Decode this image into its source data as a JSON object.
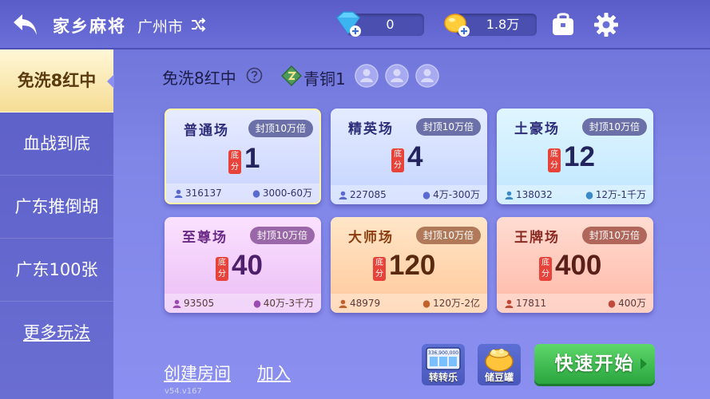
{
  "header": {
    "title": "家乡麻将",
    "city": "广州市",
    "diamonds": "0",
    "beans": "1.8万"
  },
  "sidebar": {
    "items": [
      {
        "label": "免洗8红中",
        "active": true
      },
      {
        "label": "血战到底"
      },
      {
        "label": "广东推倒胡"
      },
      {
        "label": "广东100张"
      },
      {
        "label": "更多玩法"
      }
    ]
  },
  "mode": {
    "title": "免洗8红中",
    "rank": "青铜1"
  },
  "cards": [
    {
      "name": "普通场",
      "cap": "封顶10万倍",
      "base_label": "底分",
      "base": "1",
      "players": "316137",
      "range": "3000-60万"
    },
    {
      "name": "精英场",
      "cap": "封顶10万倍",
      "base_label": "底分",
      "base": "4",
      "players": "227085",
      "range": "4万-300万"
    },
    {
      "name": "土豪场",
      "cap": "封顶10万倍",
      "base_label": "底分",
      "base": "12",
      "players": "138032",
      "range": "12万-1千万"
    },
    {
      "name": "至尊场",
      "cap": "封顶10万倍",
      "base_label": "底分",
      "base": "40",
      "players": "93505",
      "range": "40万-3千万"
    },
    {
      "name": "大师场",
      "cap": "封顶10万倍",
      "base_label": "底分",
      "base": "120",
      "players": "48979",
      "range": "120万-2亿"
    },
    {
      "name": "王牌场",
      "cap": "封顶10万倍",
      "base_label": "底分",
      "base": "400",
      "players": "17811",
      "range": "400万"
    }
  ],
  "bottom": {
    "create_room": "创建房间",
    "join": "加入",
    "version": "v54.v167",
    "spin_label": "转转乐",
    "spin_digits": "336,900,000",
    "piggy_label": "储豆罐",
    "quick_start": "快速开始"
  },
  "colors": {
    "accent_green": "#2aa640",
    "base_tag_red": "#e8433a",
    "active_tab": "#f6dd95"
  }
}
